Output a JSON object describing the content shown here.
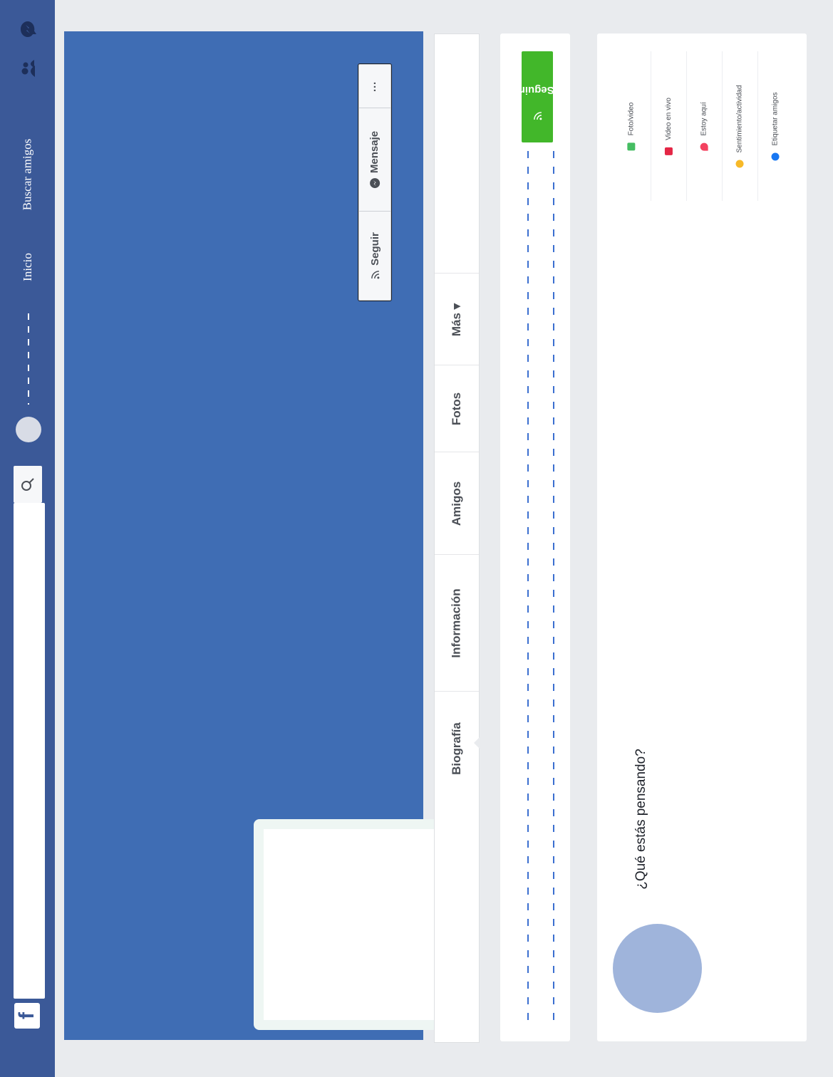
{
  "topbar": {
    "logo": "f",
    "search_placeholder": "",
    "nav": {
      "inicio": "Inicio",
      "buscar_amigos": "Buscar amigos"
    },
    "icons": [
      "friend-requests-icon",
      "messages-icon"
    ]
  },
  "cover": {
    "actions": {
      "seguir": "Seguir",
      "mensaje": "Mensaje",
      "more": "···"
    }
  },
  "tabs": {
    "biografia": "Biografía",
    "informacion": "Información",
    "amigos": "Amigos",
    "fotos": "Fotos",
    "mas": "Más ▾"
  },
  "follow_card": {
    "button_label": "Seguir"
  },
  "composer": {
    "prompt": "¿Qué estás pensando?",
    "options": {
      "foto": "Foto/video",
      "video": "Video en vivo",
      "estoy": "Estoy aquí",
      "sentimiento": "Sentimiento/actividad",
      "etiquetar": "Etiquetar amigos"
    }
  },
  "colors": {
    "brand": "#3b5998",
    "cover": "#3f6db4",
    "follow_green": "#42b72a",
    "avatar": "#9fb4db"
  }
}
